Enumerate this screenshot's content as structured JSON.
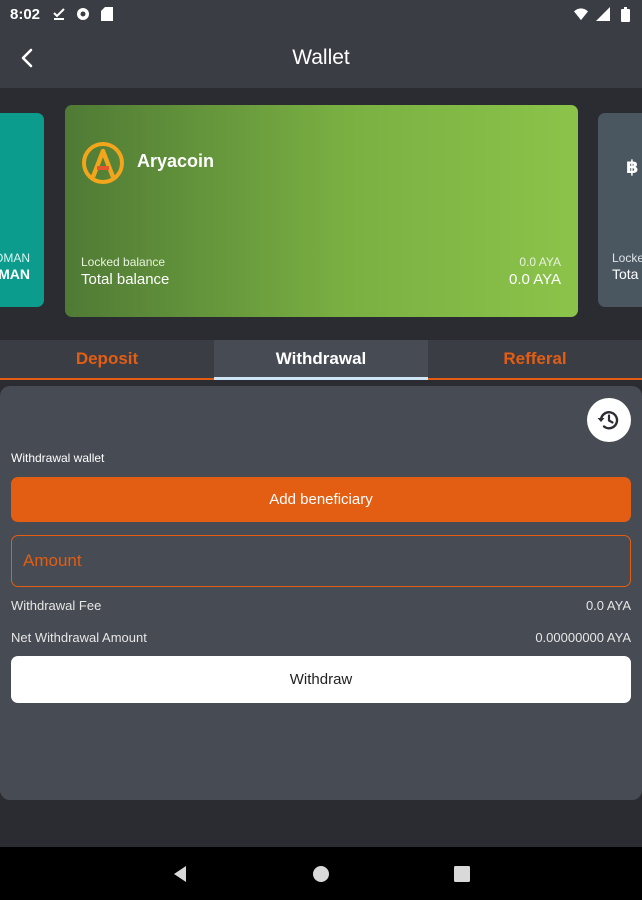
{
  "status_bar": {
    "time": "8:02",
    "icons": [
      "download-done-icon",
      "vpn-icon",
      "sd-card-icon"
    ],
    "right_icons": [
      "wifi-icon",
      "signal-icon",
      "battery-icon"
    ]
  },
  "app_bar": {
    "title": "Wallet",
    "back_icon": "arrow-back-icon"
  },
  "cards": {
    "left": {
      "line1": "OMAN",
      "line2": "MAN"
    },
    "main": {
      "coin_name": "Aryacoin",
      "logo_icon": "aryacoin-logo",
      "locked_label": "Locked balance",
      "locked_value": "0.0 AYA",
      "total_label": "Total balance",
      "total_value": "0.0 AYA",
      "gradient_start": "#4f7a35",
      "gradient_end": "#8bc34a"
    },
    "right": {
      "symbol": "฿",
      "line1": "Locke",
      "line2": "Tota"
    }
  },
  "tabs": [
    {
      "label": "Deposit",
      "active": false
    },
    {
      "label": "Withdrawal",
      "active": true
    },
    {
      "label": "Refferal",
      "active": false
    }
  ],
  "withdraw_panel": {
    "history_icon": "history-icon",
    "wallet_label": "Withdrawal wallet",
    "add_beneficiary_label": "Add beneficiary",
    "amount_placeholder": "Amount",
    "amount_value": "",
    "fee_label": "Withdrawal Fee",
    "fee_value": "0.0 AYA",
    "net_label": "Net Withdrawal Amount",
    "net_value": "0.00000000 AYA",
    "withdraw_label": "Withdraw"
  },
  "nav_bar": {
    "icons": [
      "back-triangle-icon",
      "home-circle-icon",
      "recents-square-icon"
    ]
  },
  "colors": {
    "accent": "#e35d12",
    "background": "#2a2c31",
    "panel": "#474b53",
    "bar": "#3a3d44"
  }
}
